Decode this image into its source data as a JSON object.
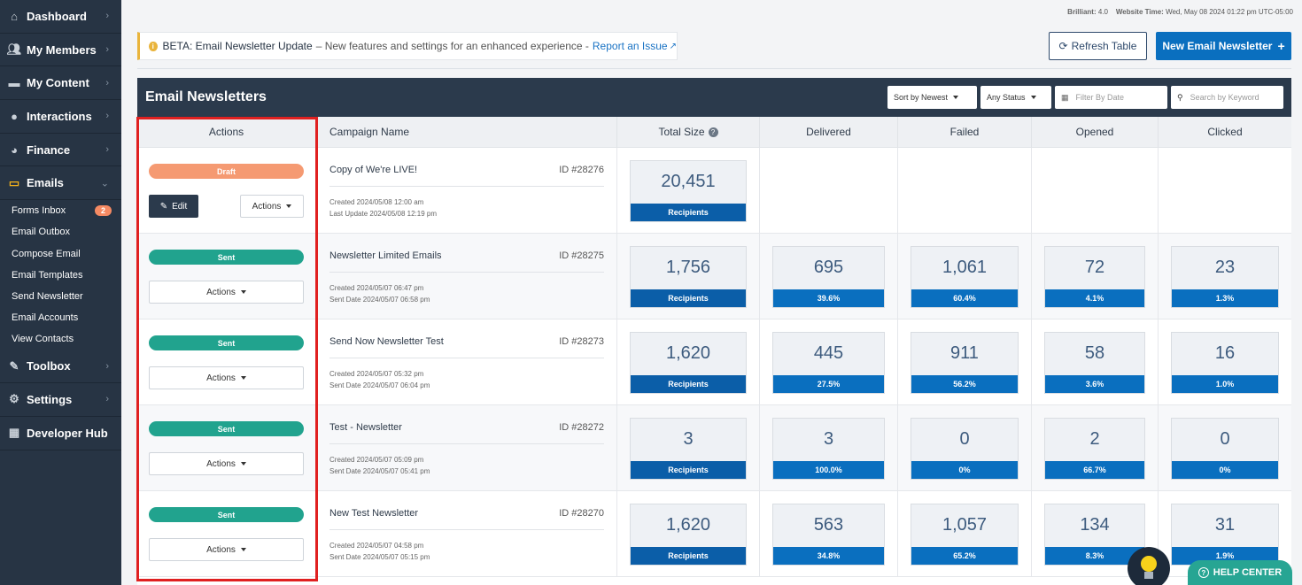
{
  "sidebar": {
    "items": [
      {
        "label": "Dashboard",
        "icon": "home-icon"
      },
      {
        "label": "My Members",
        "icon": "members-icon"
      },
      {
        "label": "My Content",
        "icon": "folder-icon"
      },
      {
        "label": "Interactions",
        "icon": "comments-icon"
      },
      {
        "label": "Finance",
        "icon": "pie-chart-icon"
      },
      {
        "label": "Emails",
        "icon": "inbox-icon"
      }
    ],
    "email_sub": [
      {
        "label": "Forms Inbox",
        "badge": "2"
      },
      {
        "label": "Email Outbox"
      },
      {
        "label": "Compose Email"
      },
      {
        "label": "Email Templates"
      },
      {
        "label": "Send Newsletter"
      },
      {
        "label": "Email Accounts"
      },
      {
        "label": "View Contacts"
      }
    ],
    "items_after": [
      {
        "label": "Toolbox",
        "icon": "wrench-icon"
      },
      {
        "label": "Settings",
        "icon": "gear-icon"
      },
      {
        "label": "Developer Hub",
        "icon": "grid-icon"
      }
    ]
  },
  "meta": {
    "version_label": "Brilliant:",
    "version": "4.0",
    "time_label": "Website Time:",
    "time": "Wed, May 08 2024 01:22 pm UTC-05:00"
  },
  "beta": {
    "title": "BETA: Email Newsletter Update",
    "text": "– New features and settings for an enhanced experience -",
    "link": "Report an Issue"
  },
  "buttons": {
    "refresh": "Refresh Table",
    "new": "New Email Newsletter"
  },
  "panel": {
    "title": "Email Newsletters",
    "sort": "Sort by Newest",
    "status": "Any Status",
    "date_placeholder": "Filter By Date",
    "search_placeholder": "Search by Keyword"
  },
  "columns": [
    "Actions",
    "Campaign Name",
    "Total Size",
    "Delivered",
    "Failed",
    "Opened",
    "Clicked"
  ],
  "rows": [
    {
      "status": "Draft",
      "name": "Copy of We're LIVE!",
      "id": "ID #28276",
      "meta1": "Created 2024/05/08 12:00 am",
      "meta2": "Last Update 2024/05/08 12:19 pm",
      "total": "20,451",
      "total_label": "Recipients",
      "edit": "Edit",
      "actions": "Actions"
    },
    {
      "status": "Sent",
      "name": "Newsletter Limited Emails",
      "id": "ID #28275",
      "meta1": "Created 2024/05/07 06:47 pm",
      "meta2": "Sent Date 2024/05/07 06:58 pm",
      "total": "1,756",
      "total_label": "Recipients",
      "actions": "Actions",
      "delivered": "695",
      "delivered_pct": "39.6%",
      "failed": "1,061",
      "failed_pct": "60.4%",
      "opened": "72",
      "opened_pct": "4.1%",
      "clicked": "23",
      "clicked_pct": "1.3%"
    },
    {
      "status": "Sent",
      "name": "Send Now Newsletter Test",
      "id": "ID #28273",
      "meta1": "Created 2024/05/07 05:32 pm",
      "meta2": "Sent Date 2024/05/07 06:04 pm",
      "total": "1,620",
      "total_label": "Recipients",
      "actions": "Actions",
      "delivered": "445",
      "delivered_pct": "27.5%",
      "failed": "911",
      "failed_pct": "56.2%",
      "opened": "58",
      "opened_pct": "3.6%",
      "clicked": "16",
      "clicked_pct": "1.0%"
    },
    {
      "status": "Sent",
      "name": "Test - Newsletter",
      "id": "ID #28272",
      "meta1": "Created 2024/05/07 05:09 pm",
      "meta2": "Sent Date 2024/05/07 05:41 pm",
      "total": "3",
      "total_label": "Recipients",
      "actions": "Actions",
      "delivered": "3",
      "delivered_pct": "100.0%",
      "failed": "0",
      "failed_pct": "0%",
      "opened": "2",
      "opened_pct": "66.7%",
      "clicked": "0",
      "clicked_pct": "0%"
    },
    {
      "status": "Sent",
      "name": "New Test Newsletter",
      "id": "ID #28270",
      "meta1": "Created 2024/05/07 04:58 pm",
      "meta2": "Sent Date 2024/05/07 05:15 pm",
      "total": "1,620",
      "total_label": "Recipients",
      "actions": "Actions",
      "delivered": "563",
      "delivered_pct": "34.8%",
      "failed": "1,057",
      "failed_pct": "65.2%",
      "opened": "134",
      "opened_pct": "8.3%",
      "clicked": "31",
      "clicked_pct": "1.9%"
    }
  ],
  "help": "HELP CENTER",
  "colors": {
    "sidebar": "#273444",
    "accent": "#0a6fbf",
    "sent": "#21a38e",
    "draft": "#f59a72",
    "highlight": "#e02020"
  }
}
